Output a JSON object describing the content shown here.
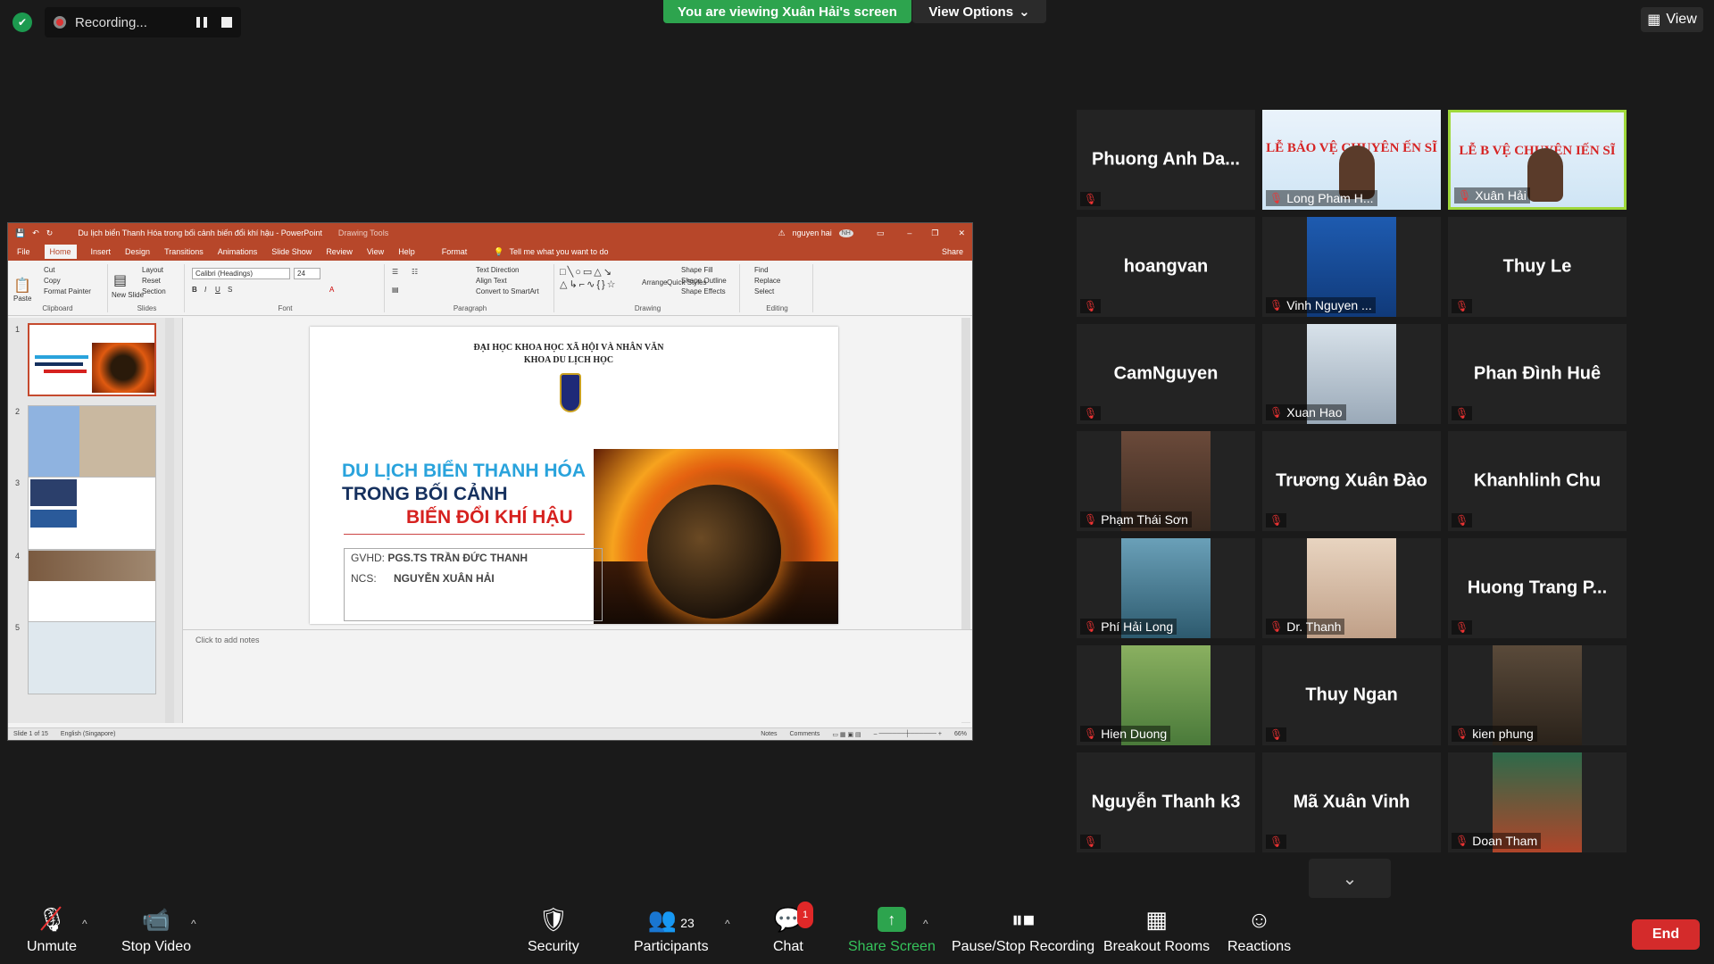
{
  "top": {
    "recording_label": "Recording...",
    "viewing_banner": "You are viewing Xuân Hải's screen",
    "view_options": "View Options",
    "view_button": "View"
  },
  "ppt": {
    "window_title": "Du lịch biển Thanh Hóa trong bối cảnh biến đổi khí hậu - PowerPoint",
    "drawing_tools": "Drawing Tools",
    "user": "nguyen hai",
    "user_initials": "NH",
    "tabs": [
      "File",
      "Home",
      "Insert",
      "Design",
      "Transitions",
      "Animations",
      "Slide Show",
      "Review",
      "View",
      "Help",
      "Format"
    ],
    "tell_me": "Tell me what you want to do",
    "share": "Share",
    "ribbon": {
      "paste": "Paste",
      "cut": "Cut",
      "copy": "Copy",
      "format_painter": "Format Painter",
      "clipboard": "Clipboard",
      "new_slide": "New Slide",
      "layout": "Layout",
      "reset": "Reset",
      "section": "Section",
      "slides": "Slides",
      "font_name": "Calibri (Headings)",
      "font_size": "24",
      "font": "Font",
      "text_direction": "Text Direction",
      "align_text": "Align Text",
      "convert_smartart": "Convert to SmartArt",
      "paragraph": "Paragraph",
      "arrange": "Arrange",
      "quick_styles": "Quick Styles",
      "shape_fill": "Shape Fill",
      "shape_outline": "Shape Outline",
      "shape_effects": "Shape Effects",
      "drawing": "Drawing",
      "find": "Find",
      "replace": "Replace",
      "select": "Select",
      "editing": "Editing"
    },
    "thumb_numbers": [
      "1",
      "2",
      "3",
      "4",
      "5"
    ],
    "slide": {
      "university": "ĐẠI HỌC KHOA HỌC XÃ HỘI VÀ NHÂN VĂN",
      "faculty": "KHOA DU LỊCH HỌC",
      "title1": "DU LỊCH BIỂN THANH HÓA",
      "title2": "TRONG BỐI CẢNH",
      "title3": "BIẾN ĐỔI KHÍ HẬU",
      "gvhd_label": "GVHD:",
      "gvhd_name": "PGS.TS TRẦN ĐỨC THANH",
      "ncs_label": "NCS:",
      "ncs_name": "NGUYỄN XUÂN HẢI"
    },
    "notes_placeholder": "Click to add notes",
    "status": {
      "slide_count": "Slide 1 of 15",
      "language": "English (Singapore)",
      "notes": "Notes",
      "comments": "Comments",
      "zoom": "66%"
    }
  },
  "participants": [
    {
      "name": "Phuong Anh Da...",
      "type": "name"
    },
    {
      "name": "Long Pham H...",
      "type": "banner",
      "banner_text": "LỄ BẢO VỆ CHUYÊN  ẾN SĨ"
    },
    {
      "name": "Xuân Hải",
      "type": "banner",
      "banner_text": "LỄ B  VỆ CHUYÊN  IẾN SĨ"
    },
    {
      "name": "hoangvan",
      "type": "name"
    },
    {
      "name": "Vinh Nguyen ...",
      "type": "photo"
    },
    {
      "name": "Thuy Le",
      "type": "name"
    },
    {
      "name": "CamNguyen",
      "type": "name"
    },
    {
      "name": "Xuan Hao",
      "type": "photo"
    },
    {
      "name": "Phan Đình Huê",
      "type": "name"
    },
    {
      "name": "Phạm Thái Sơn",
      "type": "photo"
    },
    {
      "name": "Trương Xuân Đào",
      "type": "name"
    },
    {
      "name": "Khanhlinh Chu",
      "type": "name"
    },
    {
      "name": "Phí Hải Long",
      "type": "photo"
    },
    {
      "name": "Dr. Thanh",
      "type": "photo"
    },
    {
      "name": "Huong Trang P...",
      "type": "name"
    },
    {
      "name": "Hien Duong",
      "type": "photo"
    },
    {
      "name": "Thuy Ngan",
      "type": "name"
    },
    {
      "name": "kien phung",
      "type": "photo"
    },
    {
      "name": "Nguyễn Thanh k3",
      "type": "name"
    },
    {
      "name": "Mã Xuân Vinh",
      "type": "name"
    },
    {
      "name": "Doan Tham",
      "type": "photo"
    }
  ],
  "toolbar": {
    "unmute": "Unmute",
    "stop_video": "Stop Video",
    "security": "Security",
    "participants": "Participants",
    "participants_count": "23",
    "chat": "Chat",
    "chat_badge": "1",
    "share_screen": "Share Screen",
    "pause_stop_recording": "Pause/Stop Recording",
    "breakout_rooms": "Breakout Rooms",
    "reactions": "Reactions",
    "end": "End"
  },
  "colors": {
    "accent_green": "#2da44e",
    "ppt_red": "#b7472a",
    "end_red": "#d42b2b",
    "highlight": "#9fd83a"
  }
}
